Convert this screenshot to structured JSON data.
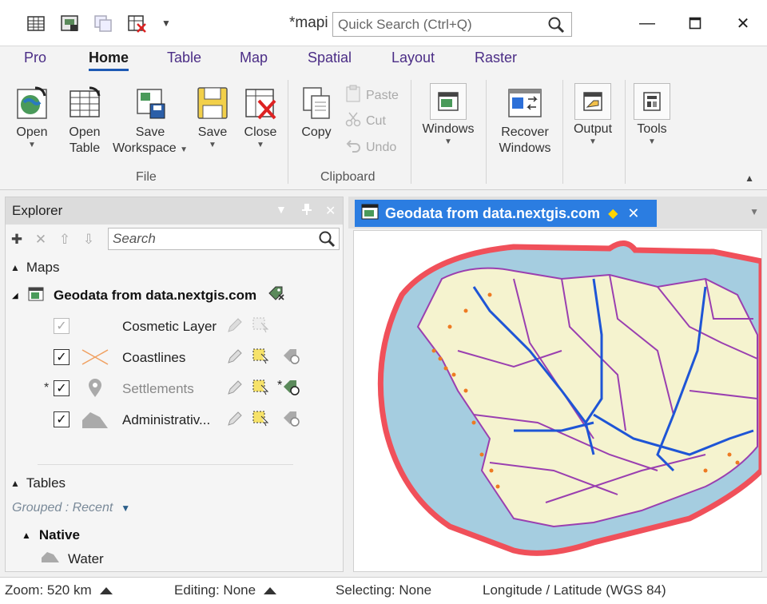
{
  "window": {
    "title": "*mapi",
    "quick_search_placeholder": "Quick Search (Ctrl+Q)"
  },
  "ribbon": {
    "tabs": [
      "Pro",
      "Home",
      "Table",
      "Map",
      "Spatial",
      "Layout",
      "Raster"
    ],
    "active_tab": "Home",
    "file": {
      "open": "Open",
      "open_table_1": "Open",
      "open_table_2": "Table",
      "save_ws_1": "Save",
      "save_ws_2": "Workspace",
      "save": "Save",
      "close": "Close",
      "group": "File"
    },
    "clipboard": {
      "copy": "Copy",
      "paste": "Paste",
      "cut": "Cut",
      "undo": "Undo",
      "group": "Clipboard"
    },
    "windows": "Windows",
    "recover_1": "Recover",
    "recover_2": "Windows",
    "output": "Output",
    "tools": "Tools"
  },
  "explorer": {
    "title": "Explorer",
    "search_placeholder": "Search",
    "maps_label": "Maps",
    "map_name": "Geodata from data.nextgis.com",
    "layers": [
      {
        "name": "Cosmetic Layer",
        "checked": true
      },
      {
        "name": "Coastlines",
        "checked": true
      },
      {
        "name": "Settlements",
        "checked": true
      },
      {
        "name": "Administrativ...",
        "checked": true
      }
    ],
    "tables_label": "Tables",
    "grouped_label": "Grouped : Recent",
    "native_label": "Native",
    "water_label": "Water"
  },
  "document": {
    "tab_title": "Geodata from data.nextgis.com"
  },
  "status": {
    "zoom": "Zoom: 520 km",
    "editing": "Editing: None",
    "selecting": "Selecting: None",
    "projection": "Longitude / Latitude (WGS 84)"
  },
  "colors": {
    "accent": "#2b7de1",
    "tab_text": "#4b2d86",
    "land": "#f5f3cf",
    "water": "#a5cde0",
    "buffer_outline": "#f0505a",
    "admin_lines": "#9a3fb0",
    "rivers": "#1e55d6",
    "settlements": "#ee7a22"
  }
}
